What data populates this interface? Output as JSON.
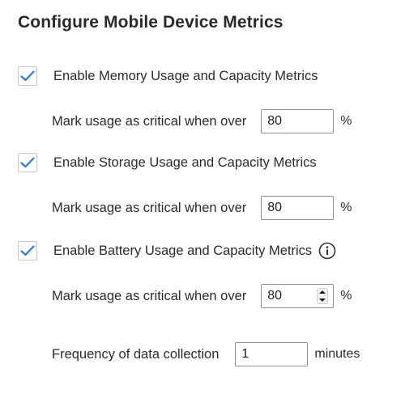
{
  "page": {
    "title": "Configure Mobile Device Metrics"
  },
  "colors": {
    "check": "#2f7be0",
    "input_border": "#8d8d8d",
    "checkbox_border": "#c9c9c9"
  },
  "memory": {
    "checkbox_checked": true,
    "label": "Enable Memory Usage and Capacity Metrics",
    "threshold_label": "Mark usage as critical when over",
    "threshold_value": "80",
    "unit": "%"
  },
  "storage": {
    "checkbox_checked": true,
    "label": "Enable Storage Usage and Capacity Metrics",
    "threshold_label": "Mark usage as critical when over",
    "threshold_value": "80",
    "unit": "%"
  },
  "battery": {
    "checkbox_checked": true,
    "label": "Enable Battery Usage and Capacity Metrics",
    "info_icon": "info-circle-icon",
    "threshold_label": "Mark usage as critical when over",
    "threshold_value": "80",
    "unit": "%"
  },
  "frequency": {
    "label": "Frequency of data collection",
    "value": "1",
    "unit": "minutes"
  }
}
